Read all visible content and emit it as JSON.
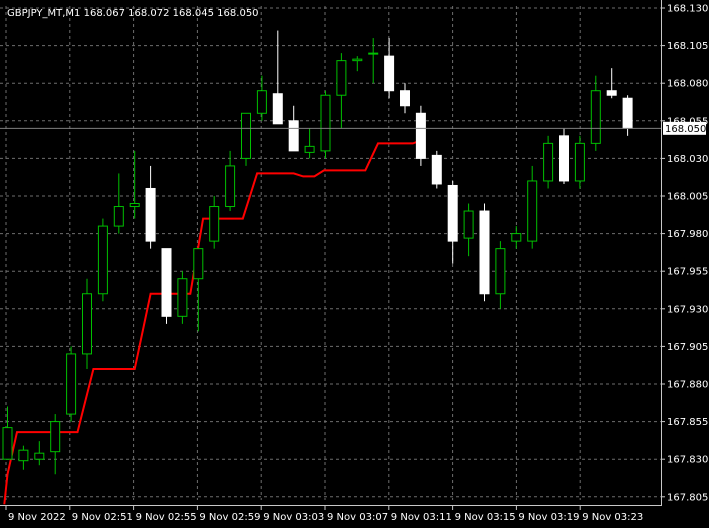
{
  "header": {
    "symbol_line": "GBPJPY_MT,M1  168.067 168.072 168.045 168.050"
  },
  "current_price_label": "168.050",
  "colors": {
    "background": "#000000",
    "grid": "#6e6e6e",
    "axis": "#c8c8c8",
    "bull_candle": "#00c000",
    "bear_candle": "#ffffff",
    "indicator": "#ff0000",
    "price_line": "#7f7f7f"
  },
  "chart_data": {
    "type": "candlestick",
    "title": "GBPJPY_MT,M1",
    "x_tick_labels": [
      "9 Nov 2022",
      "9 Nov 02:51",
      "9 Nov 02:55",
      "9 Nov 02:59",
      "9 Nov 03:03",
      "9 Nov 03:07",
      "9 Nov 03:11",
      "9 Nov 03:15",
      "9 Nov 03:19",
      "9 Nov 03:23"
    ],
    "y_tick_labels": [
      "168.130",
      "168.105",
      "168.080",
      "168.055",
      "168.030",
      "168.005",
      "167.980",
      "167.955",
      "167.930",
      "167.905",
      "167.880",
      "167.855",
      "167.830",
      "167.805"
    ],
    "ylim": [
      167.8,
      168.13
    ],
    "grid": true,
    "current_price": 168.05,
    "candles": [
      {
        "o": 167.83,
        "h": 167.865,
        "l": 167.83,
        "c": 167.851
      },
      {
        "o": 167.829,
        "h": 167.839,
        "l": 167.823,
        "c": 167.836
      },
      {
        "o": 167.83,
        "h": 167.842,
        "l": 167.826,
        "c": 167.834
      },
      {
        "o": 167.835,
        "h": 167.86,
        "l": 167.82,
        "c": 167.855
      },
      {
        "o": 167.86,
        "h": 167.905,
        "l": 167.855,
        "c": 167.9
      },
      {
        "o": 167.9,
        "h": 167.95,
        "l": 167.89,
        "c": 167.94
      },
      {
        "o": 167.94,
        "h": 167.99,
        "l": 167.935,
        "c": 167.985
      },
      {
        "o": 167.985,
        "h": 168.02,
        "l": 167.98,
        "c": 167.998
      },
      {
        "o": 167.998,
        "h": 168.035,
        "l": 167.99,
        "c": 168.0
      },
      {
        "o": 168.01,
        "h": 168.025,
        "l": 167.97,
        "c": 167.975
      },
      {
        "o": 167.97,
        "h": 167.97,
        "l": 167.92,
        "c": 167.925
      },
      {
        "o": 167.925,
        "h": 167.955,
        "l": 167.92,
        "c": 167.95
      },
      {
        "o": 167.95,
        "h": 167.96,
        "l": 167.915,
        "c": 167.97
      },
      {
        "o": 167.975,
        "h": 168.005,
        "l": 167.97,
        "c": 167.998
      },
      {
        "o": 167.998,
        "h": 168.035,
        "l": 167.995,
        "c": 168.025
      },
      {
        "o": 168.03,
        "h": 168.06,
        "l": 168.025,
        "c": 168.06
      },
      {
        "o": 168.06,
        "h": 168.085,
        "l": 168.055,
        "c": 168.075
      },
      {
        "o": 168.073,
        "h": 168.115,
        "l": 168.07,
        "c": 168.053
      },
      {
        "o": 168.055,
        "h": 168.065,
        "l": 168.035,
        "c": 168.035
      },
      {
        "o": 168.034,
        "h": 168.05,
        "l": 168.03,
        "c": 168.038
      },
      {
        "o": 168.035,
        "h": 168.075,
        "l": 168.03,
        "c": 168.072
      },
      {
        "o": 168.072,
        "h": 168.1,
        "l": 168.05,
        "c": 168.095
      },
      {
        "o": 168.095,
        "h": 168.098,
        "l": 168.088,
        "c": 168.096
      },
      {
        "o": 168.1,
        "h": 168.11,
        "l": 168.08,
        "c": 168.1
      },
      {
        "o": 168.098,
        "h": 168.11,
        "l": 168.07,
        "c": 168.075
      },
      {
        "o": 168.075,
        "h": 168.08,
        "l": 168.06,
        "c": 168.065
      },
      {
        "o": 168.06,
        "h": 168.065,
        "l": 168.025,
        "c": 168.03
      },
      {
        "o": 168.032,
        "h": 168.035,
        "l": 168.01,
        "c": 168.013
      },
      {
        "o": 168.012,
        "h": 168.015,
        "l": 167.96,
        "c": 167.975
      },
      {
        "o": 167.977,
        "h": 168.0,
        "l": 167.965,
        "c": 167.995
      },
      {
        "o": 167.995,
        "h": 168.0,
        "l": 167.935,
        "c": 167.94
      },
      {
        "o": 167.94,
        "h": 167.975,
        "l": 167.93,
        "c": 167.97
      },
      {
        "o": 167.975,
        "h": 167.985,
        "l": 167.97,
        "c": 167.98
      },
      {
        "o": 167.975,
        "h": 168.025,
        "l": 167.97,
        "c": 168.015
      },
      {
        "o": 168.015,
        "h": 168.045,
        "l": 168.01,
        "c": 168.04
      },
      {
        "o": 168.045,
        "h": 168.05,
        "l": 168.013,
        "c": 168.015
      },
      {
        "o": 168.015,
        "h": 168.045,
        "l": 168.01,
        "c": 168.04
      },
      {
        "o": 168.04,
        "h": 168.085,
        "l": 168.035,
        "c": 168.075
      },
      {
        "o": 168.075,
        "h": 168.09,
        "l": 168.07,
        "c": 168.072
      },
      {
        "o": 168.07,
        "h": 168.072,
        "l": 168.045,
        "c": 168.05
      }
    ],
    "indicator_line": {
      "color": "#ff0000",
      "points": [
        {
          "i": -0.2,
          "v": 167.8
        },
        {
          "i": 0.0,
          "v": 167.82
        },
        {
          "i": 0.6,
          "v": 167.848
        },
        {
          "i": 4.4,
          "v": 167.848
        },
        {
          "i": 5.4,
          "v": 167.89
        },
        {
          "i": 8.0,
          "v": 167.89
        },
        {
          "i": 9.0,
          "v": 167.94
        },
        {
          "i": 11.5,
          "v": 167.94
        },
        {
          "i": 12.3,
          "v": 167.99
        },
        {
          "i": 14.8,
          "v": 167.99
        },
        {
          "i": 15.7,
          "v": 168.02
        },
        {
          "i": 18.0,
          "v": 168.02
        },
        {
          "i": 18.6,
          "v": 168.018
        },
        {
          "i": 19.3,
          "v": 168.018
        },
        {
          "i": 19.9,
          "v": 168.022
        },
        {
          "i": 22.5,
          "v": 168.022
        },
        {
          "i": 23.3,
          "v": 168.04
        },
        {
          "i": 25.0,
          "v": 168.04
        },
        {
          "i": 25.5,
          "v": 168.04
        },
        {
          "i": 26.0,
          "v": 168.042
        }
      ]
    }
  }
}
